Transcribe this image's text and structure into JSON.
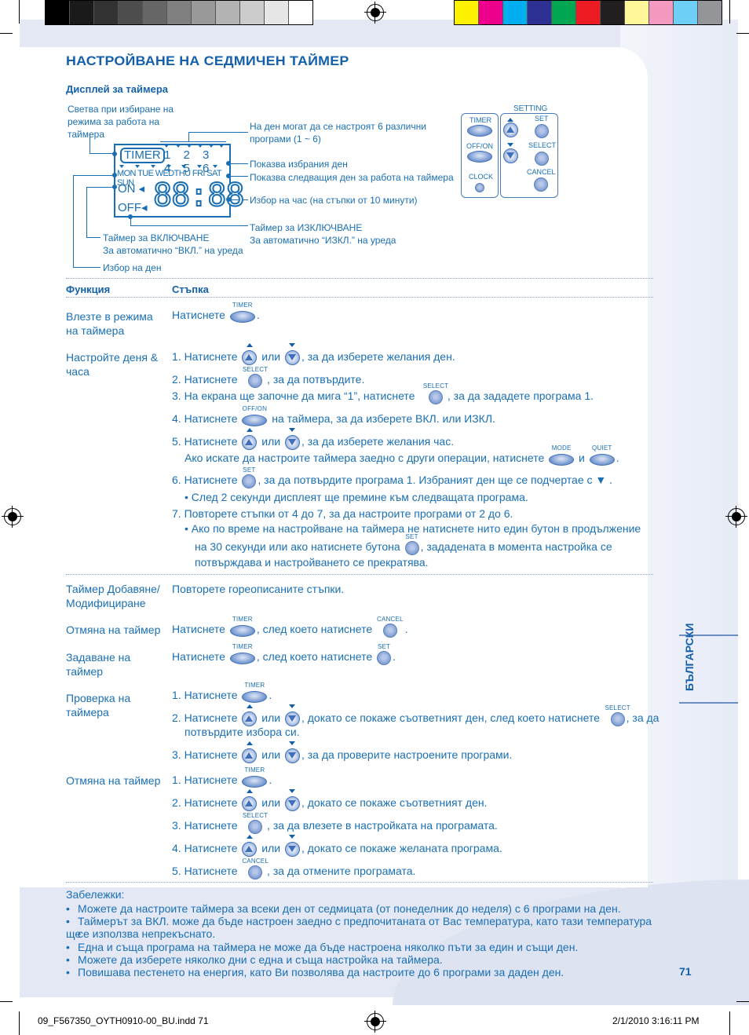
{
  "title": "НАСТРОЙВАНЕ НА СЕДМИЧЕН ТАЙМЕР",
  "display_section": {
    "heading": "Дисплей за таймера",
    "lcd": {
      "timer_label": "TIMER",
      "programs": "1 2 3 4 5 6",
      "days": "MON TUE WEDTHU FRI  SAT SUN",
      "on_label": "ON",
      "off_label": "OFF",
      "digits": "88:88"
    },
    "callouts": {
      "timer_light": "Светва при избиране на режима за работа на таймера",
      "programs": "На ден могат да се настроят 6 различни програми (1 ~ 6)",
      "selected_day": "Показва избрания ден",
      "next_day": "Показва следващия ден за работа на таймера",
      "time_select": "Избор на час (на стъпки от 10 минути)",
      "off_timer_1": "Таймер за ИЗКЛЮЧВАНЕ",
      "off_timer_2": "За автоматично “ИЗКЛ.” на уреда",
      "on_timer_1": "Таймер за ВКЛЮЧВАНЕ",
      "on_timer_2": "За автоматично “ВКЛ.” на уреда",
      "day_select": "Избор на ден"
    }
  },
  "remote": {
    "setting_label": "SETTING",
    "timer": "TIMER",
    "offon": "OFF/ON",
    "clock": "CLOCK",
    "set": "SET",
    "select": "SELECT",
    "cancel": "CANCEL"
  },
  "captions": {
    "timer": "TIMER",
    "select": "SELECT",
    "offon": "OFF/ON",
    "set": "SET",
    "mode": "MODE",
    "quiet": "QUIET",
    "cancel": "CANCEL"
  },
  "table": {
    "col_function": "Функция",
    "col_step": "Стъпка",
    "rows": [
      {
        "function": "Влезте в режима на таймера",
        "steps": {
          "s1a": "Натиснете",
          "s1b": "."
        }
      },
      {
        "function": "Настройте деня & часа",
        "steps": {
          "s1a": "1. Натиснете",
          "s1b": "или",
          "s1c": ", за да изберете желания ден.",
          "s2a": "2. Натиснете",
          "s2b": ", за да потвърдите.",
          "s3a": "3. На екрана ще започне да мига “1”, натиснете",
          "s3b": ", за да зададете програма 1.",
          "s4a": "4. Натиснете",
          "s4b": "на таймера, за да изберете ВКЛ. или ИЗКЛ.",
          "s5a": "5. Натиснете",
          "s5b": "или",
          "s5c": ", за да изберете желания час.",
          "s5d": "Ако искате да настроите таймера заедно с други операции, натиснете",
          "s5e": "и",
          "s5f": ".",
          "s6a": "6. Натиснете",
          "s6b": ", за да потвърдите програма 1. Избраният ден ще се подчертае с ▼ .",
          "s6c": "• След 2 секунди дисплеят ще премине към следващата програма.",
          "s7a": "7. Повторете стъпки от 4 до 7, за да настроите програми от 2 до 6.",
          "s7b": "• Ако по време на настройване на таймера не натиснете нито един бутон в продължение",
          "s7c": "на 30 секунди или ако натиснете бутона",
          "s7d": ", зададената в момента настройка се",
          "s7e": "потвърждава и настройването се прекратява."
        }
      },
      {
        "function": "Таймер Добавяне/ Модифициране",
        "steps": {
          "s1a": "Повторете гореописаните стъпки."
        }
      },
      {
        "function": "Отмяна на таймер",
        "steps": {
          "s1a": "Натиснете",
          "s1b": ", след което натиснете",
          "s1c": "."
        }
      },
      {
        "function": "Задаване на таймер",
        "steps": {
          "s1a": "Натиснете",
          "s1b": ", след което натиснете",
          "s1c": "."
        }
      },
      {
        "function": "Проверка на таймера",
        "steps": {
          "s1a": "1. Натиснете",
          "s1b": ".",
          "s2a": "2. Натиснете",
          "s2b": "или",
          "s2c": ", докато се покаже съответният ден, след което натиснете",
          "s2d": ", за да",
          "s2e": "потвърдите избора си.",
          "s3a": "3. Натиснете",
          "s3b": "или",
          "s3c": ", за да проверите настроените програми."
        }
      },
      {
        "function": "Отмяна на таймер",
        "steps": {
          "s1a": "1. Натиснете",
          "s1b": ".",
          "s2a": "2. Натиснете",
          "s2b": "или",
          "s2c": ", докато се покаже съответният ден.",
          "s3a": "3. Натиснете",
          "s3b": ", за да влезете в настройката на програмата.",
          "s4a": "4. Натиснете",
          "s4b": "или",
          "s4c": ", докато се покаже желаната програма.",
          "s5a": "5. Натиснете",
          "s5b": ", за да отмените програмата."
        }
      }
    ]
  },
  "notes": {
    "heading": "Забележки:",
    "items": [
      "Можете да настроите таймера за всеки ден от седмицата (от понеделник до неделя) с 6 програми на ден.",
      "Таймерът за ВКЛ. може да бъде настроен заедно с предпочитаната от Вас температура, като тази температура ще",
      "се използва непрекъснато.",
      "Една и съща програма на таймера не може да бъде настроена няколко пъти за един и същи ден.",
      "Можете да изберете няколко дни с една и съща настройка на таймера.",
      "Повишава пестенето на енергия, като Ви позволява да настроите до 6 програми за даден ден."
    ]
  },
  "language_tab": "БЪЛГАРСКИ",
  "page_number": "71",
  "slug": {
    "file": "09_F567350_OYTH0910-00_BU.indd   71",
    "date": "2/1/2010   3:16:11 PM"
  },
  "swatches": {
    "gray": [
      "#000000",
      "#1a1a1a",
      "#333333",
      "#4d4d4d",
      "#666666",
      "#808080",
      "#999999",
      "#b3b3b3",
      "#cccccc",
      "#e6e6e6",
      "#ffffff"
    ],
    "color": [
      "#fff200",
      "#ec008c",
      "#00aeef",
      "#2e3192",
      "#00a651",
      "#ed1c24",
      "#231f20",
      "#fff799",
      "#f49ac1",
      "#6dcff6",
      "#939598"
    ]
  }
}
